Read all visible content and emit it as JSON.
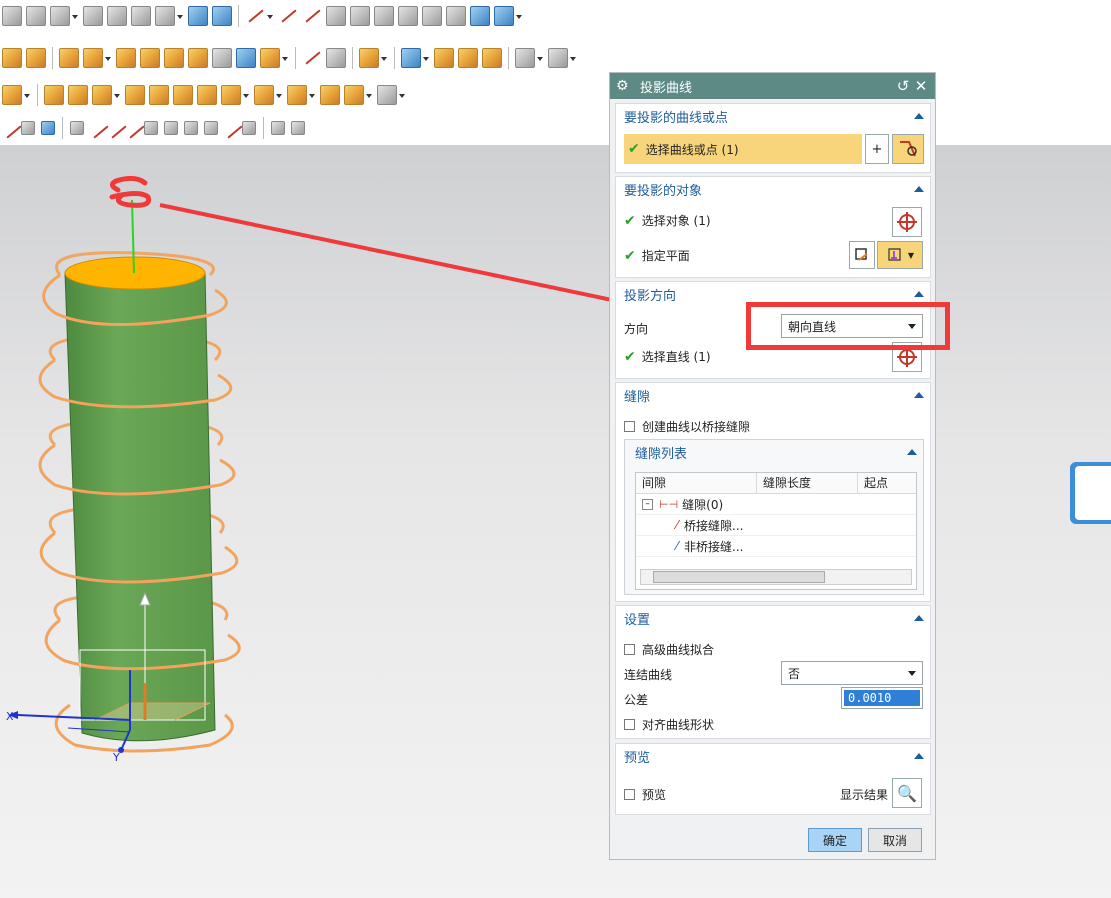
{
  "viewport": {
    "axis_x": "X",
    "axis_y": "Y"
  },
  "dialog": {
    "title": "投影曲线",
    "sec_curve": {
      "header": "要投影的曲线或点",
      "select_label": "选择曲线或点 (1)"
    },
    "sec_target": {
      "header": "要投影的对象",
      "select_object": "选择对象 (1)",
      "specify_plane": "指定平面"
    },
    "sec_direction": {
      "header": "投影方向",
      "direction_label": "方向",
      "direction_value": "朝向直线",
      "select_line": "选择直线 (1)"
    },
    "sec_gap": {
      "header": "缝隙",
      "create_bridge": "创建曲线以桥接缝隙",
      "list_header": "缝隙列表",
      "columns": [
        "间隙",
        "缝隙长度",
        "起点"
      ],
      "tree": {
        "root": "缝隙(0)",
        "child1": "桥接缝隙...",
        "child2": "非桥接缝..."
      }
    },
    "sec_settings": {
      "header": "设置",
      "advanced_fit": "高级曲线拟合",
      "join_label": "连结曲线",
      "join_value": "否",
      "tolerance_label": "公差",
      "tolerance_value": "0.0010",
      "align_shape": "对齐曲线形状"
    },
    "sec_preview": {
      "header": "预览",
      "preview_label": "预览",
      "show_result": "显示结果"
    },
    "ok_label": "确定",
    "cancel_label": "取消"
  },
  "colors": {
    "title_bar": "#5e8a86",
    "section_header": "#1f5d9a",
    "selected_row": "#f8d57a",
    "cylinder": "#63a052",
    "cylinder_top": "#ffb400",
    "helix": "#f2a35c",
    "annotation": "#f03a3a"
  }
}
